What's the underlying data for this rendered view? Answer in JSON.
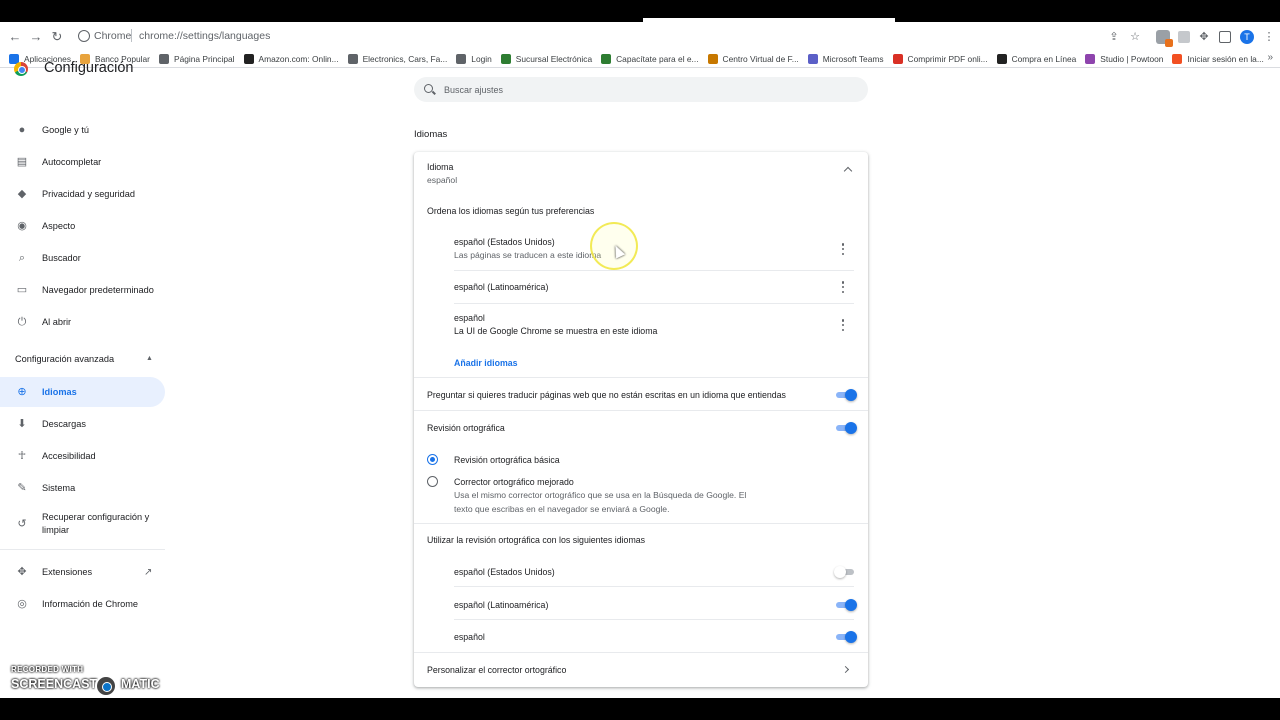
{
  "browser": {
    "tab_label": "Chrome",
    "url": "chrome://settings/languages",
    "avatar_letter": "T"
  },
  "bookmarks": [
    {
      "label": "Aplicaciones",
      "icon": "apps-grid-icon",
      "color": "#1a73e8"
    },
    {
      "label": "Banco Popular",
      "icon": "bank-icon",
      "color": "#e8a33d"
    },
    {
      "label": "Página Principal",
      "icon": "globe-icon",
      "color": "#5f6368"
    },
    {
      "label": "Amazon.com: Onlin...",
      "icon": "amazon-icon",
      "color": "#222222"
    },
    {
      "label": "Electronics, Cars, Fa...",
      "icon": "page-icon",
      "color": "#5f6368"
    },
    {
      "label": "Login",
      "icon": "globe-icon",
      "color": "#5f6368"
    },
    {
      "label": "Sucursal Electrónica",
      "icon": "bank-icon",
      "color": "#2e7d32"
    },
    {
      "label": "Capacítate para el e...",
      "icon": "edit-icon",
      "color": "#2e7d32"
    },
    {
      "label": "Centro Virtual de F...",
      "icon": "bar-icon",
      "color": "#c77800"
    },
    {
      "label": "Microsoft Teams",
      "icon": "teams-icon",
      "color": "#5b5fc7"
    },
    {
      "label": "Comprimir PDF onli...",
      "icon": "heart-icon",
      "color": "#d93025"
    },
    {
      "label": "Compra en Línea",
      "icon": "shop-icon",
      "color": "#222222"
    },
    {
      "label": "Studio | Powtoon",
      "icon": "powtoon-icon",
      "color": "#8e44ad"
    },
    {
      "label": "Iniciar sesión en la...",
      "icon": "microsoft-icon",
      "color": "#f25022"
    }
  ],
  "header": {
    "title": "Configuración",
    "search_placeholder": "Buscar ajustes"
  },
  "sidebar": {
    "items": [
      {
        "label": "Google y tú",
        "icon": "person-icon"
      },
      {
        "label": "Autocompletar",
        "icon": "clipboard-icon"
      },
      {
        "label": "Privacidad y seguridad",
        "icon": "shield-icon"
      },
      {
        "label": "Aspecto",
        "icon": "palette-icon"
      },
      {
        "label": "Buscador",
        "icon": "search-icon"
      },
      {
        "label": "Navegador predeterminado",
        "icon": "browser-icon"
      },
      {
        "label": "Al abrir",
        "icon": "power-icon"
      }
    ],
    "advanced_label": "Configuración avanzada",
    "advanced_items": [
      {
        "label": "Idiomas",
        "icon": "globe-icon",
        "active": true
      },
      {
        "label": "Descargas",
        "icon": "download-icon"
      },
      {
        "label": "Accesibilidad",
        "icon": "accessibility-icon"
      },
      {
        "label": "Sistema",
        "icon": "wrench-icon"
      },
      {
        "label": "Recuperar configuración y",
        "label2": "limpiar",
        "icon": "restore-icon"
      }
    ],
    "extensions_label": "Extensiones",
    "about_label": "Información de Chrome"
  },
  "main": {
    "section_title": "Idiomas",
    "language_header": {
      "title": "Idioma",
      "value": "español"
    },
    "order_label": "Ordena los idiomas según tus preferencias",
    "languages": [
      {
        "name": "español (Estados Unidos)",
        "note": "Las páginas se traducen a este idioma"
      },
      {
        "name": "español (Latinoamérica)",
        "note": ""
      },
      {
        "name": "español",
        "note": "La UI de Google Chrome se muestra en este idioma"
      }
    ],
    "add_languages": "Añadir idiomas",
    "offer_translate": {
      "label": "Preguntar si quieres traducir páginas web que no están escritas en un idioma que entiendas",
      "enabled": true
    },
    "spellcheck": {
      "label": "Revisión ortográfica",
      "enabled": true
    },
    "spell_basic": {
      "label": "Revisión ortográfica básica",
      "selected": true
    },
    "spell_enhanced": {
      "label": "Corrector ortográfico mejorado",
      "desc1": "Usa el mismo corrector ortográfico que se usa en la Búsqueda de Google. El",
      "desc2": "texto que escribas en el navegador se enviará a Google.",
      "selected": false
    },
    "spell_languages_label": "Utilizar la revisión ortográfica con los siguientes idiomas",
    "spell_languages": [
      {
        "name": "español (Estados Unidos)",
        "enabled": false
      },
      {
        "name": "español (Latinoamérica)",
        "enabled": true
      },
      {
        "name": "español",
        "enabled": true
      }
    ],
    "customize_label": "Personalizar el corrector ortográfico"
  },
  "watermark": {
    "top": "RECORDED WITH",
    "left": "SCREENCAST",
    "right": "MATIC"
  }
}
